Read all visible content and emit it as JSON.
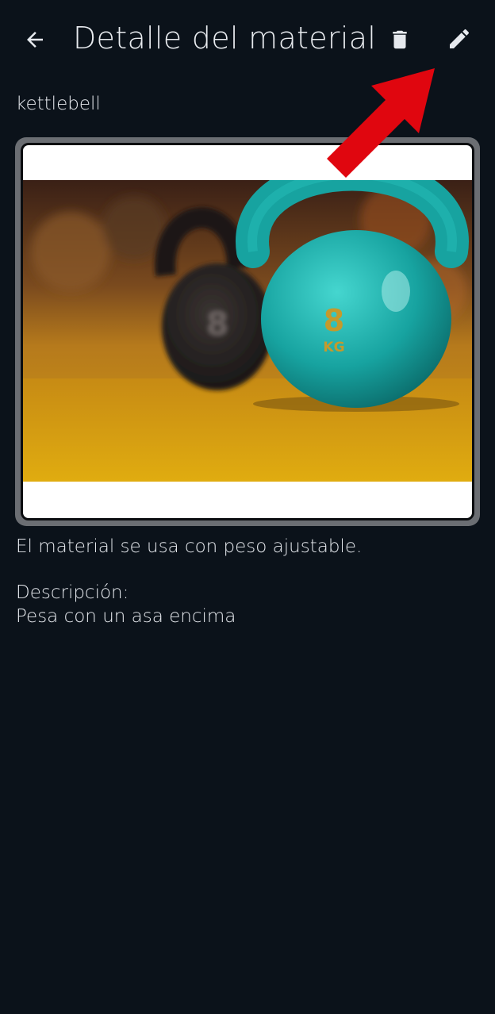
{
  "header": {
    "title": "Detalle del material",
    "back_icon": "arrow-back-icon",
    "delete_icon": "trash-icon",
    "edit_icon": "pencil-icon"
  },
  "material": {
    "name": "kettlebell",
    "photo_text_number": "8",
    "photo_text_unit": "KG",
    "usage": "El material se usa con peso ajustable.",
    "description_label": "Descripción:",
    "description": "Pesa con un asa encima"
  },
  "colors": {
    "background": "#0b121a",
    "text": "#e6e9ee",
    "annotation_arrow": "#e0060f",
    "kettlebell": "#1aa6a3"
  }
}
